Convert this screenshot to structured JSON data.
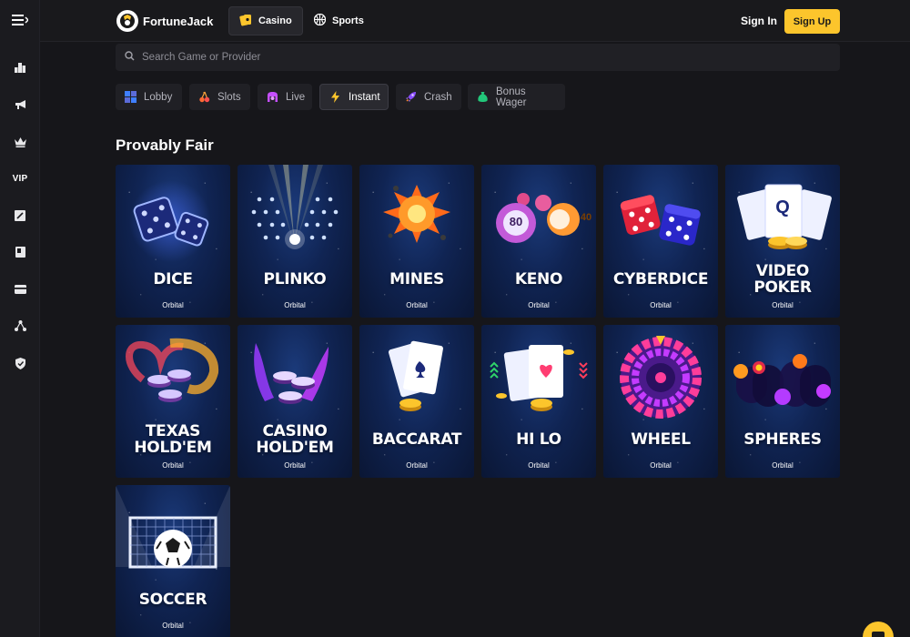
{
  "brand": {
    "name": "FortuneJack",
    "accent": "#fcc52c"
  },
  "rail": {
    "items": [
      {
        "icon": "menu-icon"
      },
      {
        "icon": "leaderboard-icon"
      },
      {
        "icon": "megaphone-icon"
      },
      {
        "icon": "crown-icon"
      },
      {
        "icon": "vip-text",
        "label": "VIP"
      },
      {
        "icon": "ticket-icon"
      },
      {
        "icon": "book-icon"
      },
      {
        "icon": "card-icon"
      },
      {
        "icon": "network-icon"
      },
      {
        "icon": "shield-icon"
      }
    ]
  },
  "header": {
    "nav": [
      {
        "label": "Casino",
        "icon": "casino-icon",
        "active": true
      },
      {
        "label": "Sports",
        "icon": "basketball-icon",
        "active": false
      }
    ],
    "sign_in": "Sign In",
    "sign_up": "Sign Up"
  },
  "search": {
    "placeholder": "Search Game or Provider"
  },
  "categories": [
    {
      "label": "Lobby",
      "icon": "grid-icon"
    },
    {
      "label": "Slots",
      "icon": "cherry-icon"
    },
    {
      "label": "Live",
      "icon": "live-dealer-icon"
    },
    {
      "label": "Instant",
      "icon": "lightning-icon",
      "active": true
    },
    {
      "label": "Crash",
      "icon": "rocket-icon"
    },
    {
      "label": "Bonus Wager",
      "icon": "money-bag-icon"
    }
  ],
  "section": {
    "title": "Provably Fair"
  },
  "games": [
    {
      "title": "DICE",
      "provider": "Orbital"
    },
    {
      "title": "PLINKO",
      "provider": "Orbital"
    },
    {
      "title": "MINES",
      "provider": "Orbital"
    },
    {
      "title": "KENO",
      "provider": "Orbital",
      "balls": [
        "80",
        "40"
      ]
    },
    {
      "title": "CYBERDICE",
      "provider": "Orbital"
    },
    {
      "title": "VIDEO POKER",
      "title_lines": [
        "VIDEO",
        "POKER"
      ],
      "provider": "Orbital",
      "card_letter": "Q"
    },
    {
      "title": "TEXAS HOLD'EM",
      "title_lines": [
        "TEXAS",
        "HOLD'EM"
      ],
      "provider": "Orbital"
    },
    {
      "title": "CASINO HOLD'EM",
      "title_lines": [
        "CASINO",
        "HOLD'EM"
      ],
      "provider": "Orbital"
    },
    {
      "title": "BACCARAT",
      "provider": "Orbital"
    },
    {
      "title": "HI LO",
      "provider": "Orbital"
    },
    {
      "title": "WHEEL",
      "provider": "Orbital"
    },
    {
      "title": "SPHERES",
      "provider": "Orbital"
    },
    {
      "title": "SOCCER",
      "provider": "Orbital"
    }
  ]
}
